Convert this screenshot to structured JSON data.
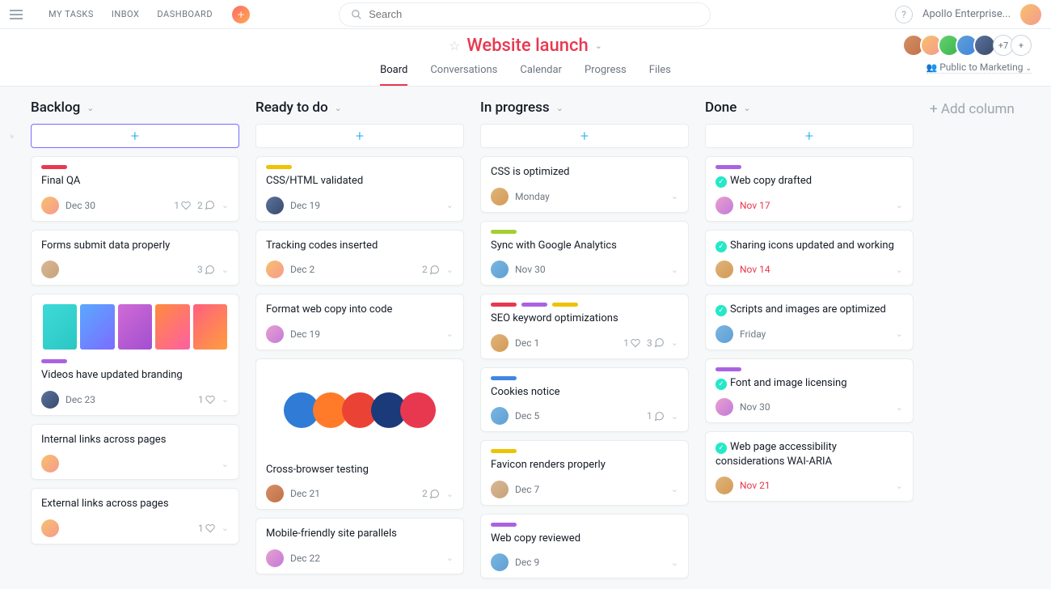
{
  "topnav": {
    "my_tasks": "MY TASKS",
    "inbox": "INBOX",
    "dashboard": "DASHBOARD"
  },
  "search": {
    "placeholder": "Search"
  },
  "org": {
    "name": "Apollo Enterprise..."
  },
  "project": {
    "title": "Website launch",
    "tabs": [
      "Board",
      "Conversations",
      "Calendar",
      "Progress",
      "Files"
    ],
    "active_tab": 0,
    "member_extra": "+7",
    "visibility": "Public to Marketing"
  },
  "add_column": "+ Add column",
  "colors": {
    "red": "#e8384f",
    "yellow": "#eec300",
    "purple": "#aa62e3",
    "blue": "#4186e0",
    "green": "#a4cf30",
    "teal": "#25e8c8"
  },
  "avatars": {
    "a1": "linear-gradient(135deg,#f8c16c,#f59a8e)",
    "a2": "linear-gradient(135deg,#cfa17a,#b8845c)",
    "a3": "linear-gradient(135deg,#e99fcf,#c17bd8)",
    "a4": "linear-gradient(135deg,#7ab6e0,#5f9fd4)",
    "a5": "linear-gradient(135deg,#5c739e,#394a6b)",
    "a6": "linear-gradient(135deg,#d68f67,#c07147)",
    "a7": "linear-gradient(135deg,#d9b896,#c7a279)",
    "a8": "linear-gradient(135deg,#e0b37b,#d39b55)"
  },
  "columns": [
    {
      "title": "Backlog",
      "outlined_add": true,
      "cards": [
        {
          "tags": [
            "red"
          ],
          "title": "Final QA",
          "avatar": "a1",
          "date": "Dec 30",
          "likes": 1,
          "comments": 2
        },
        {
          "title": "Forms submit data properly",
          "avatar": "a7",
          "date": "",
          "comments": 3
        },
        {
          "image": "gradients",
          "tags": [
            "purple"
          ],
          "title": "Videos have updated branding",
          "avatar": "a5",
          "date": "Dec 23",
          "likes": 1
        },
        {
          "title": "Internal links across pages",
          "avatar": "a1",
          "date": ""
        },
        {
          "title": "External links across pages",
          "avatar": "a1",
          "date": "",
          "likes": 1
        }
      ]
    },
    {
      "title": "Ready to do",
      "cards": [
        {
          "tags": [
            "yellow"
          ],
          "title": "CSS/HTML validated",
          "avatar": "a5",
          "date": "Dec 19"
        },
        {
          "title": "Tracking codes inserted",
          "avatar": "a1",
          "date": "Dec 2",
          "comments": 2
        },
        {
          "title": "Format web copy into code",
          "avatar": "a3",
          "date": "Dec 19"
        },
        {
          "image": "browsers",
          "title": "Cross-browser testing",
          "avatar": "a6",
          "date": "Dec 21",
          "comments": 2
        },
        {
          "title": "Mobile-friendly site parallels",
          "avatar": "a3",
          "date": "Dec 22"
        }
      ]
    },
    {
      "title": "In progress",
      "cards": [
        {
          "title": "CSS is optimized",
          "avatar": "a8",
          "date": "Monday"
        },
        {
          "tags": [
            "green"
          ],
          "title": "Sync with Google Analytics",
          "avatar": "a4",
          "date": "Nov 30"
        },
        {
          "tags": [
            "red",
            "purple",
            "yellow"
          ],
          "title": "SEO keyword optimizations",
          "avatar": "a8",
          "date": "Dec 1",
          "likes": 1,
          "comments": 3
        },
        {
          "tags": [
            "blue"
          ],
          "title": "Cookies notice",
          "avatar": "a4",
          "date": "Dec 5",
          "comments": 1
        },
        {
          "tags": [
            "yellow"
          ],
          "title": "Favicon renders properly",
          "avatar": "a7",
          "date": "Dec 7"
        },
        {
          "tags": [
            "purple"
          ],
          "title": "Web copy reviewed",
          "avatar": "a4",
          "date": "Dec 9"
        }
      ]
    },
    {
      "title": "Done",
      "cards": [
        {
          "tags": [
            "purple"
          ],
          "done": true,
          "title": "Web copy drafted",
          "avatar": "a3",
          "date": "Nov 17",
          "date_red": true
        },
        {
          "done": true,
          "title": "Sharing icons updated and working",
          "avatar": "a8",
          "date": "Nov 14",
          "date_red": true
        },
        {
          "done": true,
          "title": "Scripts and images are optimized",
          "avatar": "a4",
          "date": "Friday"
        },
        {
          "tags": [
            "purple"
          ],
          "done": true,
          "title": "Font and image licensing",
          "avatar": "a3",
          "date": "Nov 30"
        },
        {
          "done": true,
          "title": "Web page accessibility considerations WAI-ARIA",
          "avatar": "a8",
          "date": "Nov 21",
          "date_red": true
        }
      ]
    }
  ]
}
